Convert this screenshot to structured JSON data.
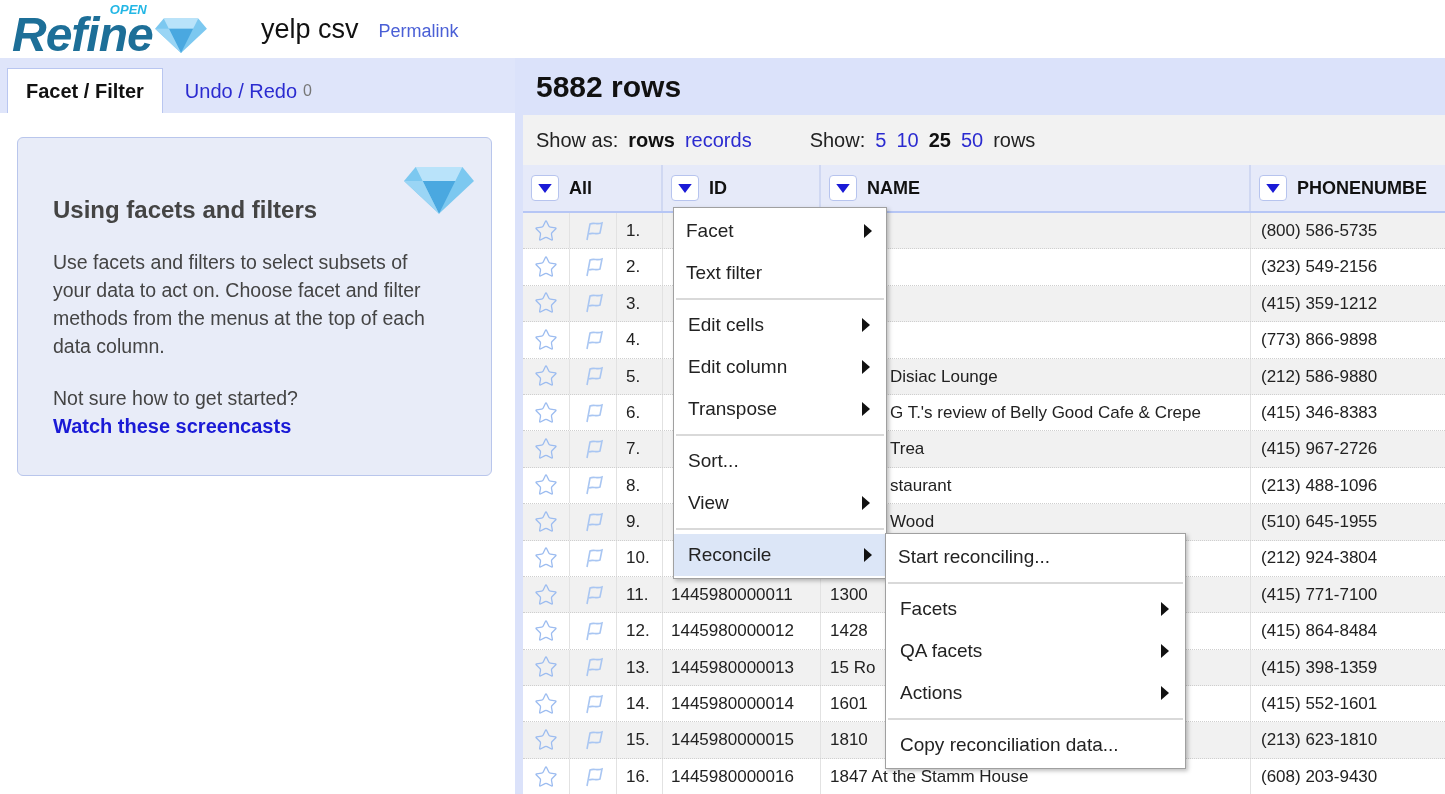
{
  "logo": {
    "word": "Refine",
    "tag": "OPEN"
  },
  "project": {
    "title": "yelp csv",
    "permalink": "Permalink"
  },
  "left_tabs": [
    {
      "label": "Facet / Filter",
      "selected": true
    },
    {
      "label": "Undo / Redo",
      "count": "0",
      "selected": false
    }
  ],
  "help_card": {
    "title": "Using facets and filters",
    "body": "Use facets and filters to select subsets of your data to act on. Choose facet and filter methods from the menus at the top of each data column.",
    "question": "Not sure how to get started?",
    "link": "Watch these screencasts"
  },
  "row_count": "5882 rows",
  "view_bar": {
    "show_as_label": "Show as:",
    "modes": [
      {
        "label": "rows",
        "selected": true
      },
      {
        "label": "records",
        "selected": false
      }
    ],
    "show_label": "Show:",
    "sizes": [
      {
        "label": "5",
        "selected": false
      },
      {
        "label": "10",
        "selected": false
      },
      {
        "label": "25",
        "selected": true
      },
      {
        "label": "50",
        "selected": false
      }
    ],
    "unit": "rows"
  },
  "table": {
    "columns": [
      "All",
      "ID",
      "NAME",
      "PHONENUMBE"
    ],
    "rows": [
      {
        "n": "1.",
        "phone": "(800) 586-5735"
      },
      {
        "n": "2.",
        "phone": "(323) 549-2156"
      },
      {
        "n": "3.",
        "phone": "(415) 359-1212"
      },
      {
        "n": "4.",
        "phone": "(773) 866-9898"
      },
      {
        "n": "5.",
        "name": "Disiac Lounge",
        "name_covered": true,
        "phone": "(212) 586-9880"
      },
      {
        "n": "6.",
        "name": "G T.'s review of Belly Good Cafe & Crepe",
        "name_covered": true,
        "phone": "(415) 346-8383"
      },
      {
        "n": "7.",
        "name": "Trea",
        "name_covered": true,
        "phone": "(415) 967-2726"
      },
      {
        "n": "8.",
        "name": "staurant",
        "name_covered": true,
        "phone": "(213) 488-1096"
      },
      {
        "n": "9.",
        "name": "Wood",
        "name_covered": true,
        "phone": "(510) 645-1955"
      },
      {
        "n": "10.",
        "phone": "(212) 924-3804"
      },
      {
        "n": "11.",
        "id": "1445980000011",
        "name": "1300",
        "name_covered": false,
        "phone": "(415) 771-7100"
      },
      {
        "n": "12.",
        "id": "1445980000012",
        "name": "1428",
        "name_covered": false,
        "phone": "(415) 864-8484"
      },
      {
        "n": "13.",
        "id": "1445980000013",
        "name": "15 Ro",
        "name_covered": false,
        "phone": "(415) 398-1359"
      },
      {
        "n": "14.",
        "id": "1445980000014",
        "name": "1601",
        "name_covered": false,
        "phone": "(415) 552-1601"
      },
      {
        "n": "15.",
        "id": "1445980000015",
        "name": "1810",
        "name_covered": false,
        "phone": "(213) 623-1810"
      },
      {
        "n": "16.",
        "id": "1445980000016",
        "name": "1847 At the Stamm House",
        "name_covered": false,
        "phone": "(608) 203-9430"
      }
    ]
  },
  "column_menu": {
    "sections": [
      [
        {
          "label": "Facet",
          "submenu": true,
          "selected": false
        },
        {
          "label": "Text filter",
          "submenu": false,
          "selected": false
        }
      ],
      [
        {
          "label": "Edit cells",
          "submenu": true,
          "selected": false
        },
        {
          "label": "Edit column",
          "submenu": true,
          "selected": false
        },
        {
          "label": "Transpose",
          "submenu": true,
          "selected": false
        }
      ],
      [
        {
          "label": "Sort...",
          "submenu": false,
          "selected": false
        },
        {
          "label": "View",
          "submenu": true,
          "selected": false
        }
      ],
      [
        {
          "label": "Reconcile",
          "submenu": true,
          "selected": true
        }
      ]
    ]
  },
  "submenu": {
    "sections": [
      [
        {
          "label": "Start reconciling...",
          "submenu": false,
          "selected": false
        }
      ],
      [
        {
          "label": "Facets",
          "submenu": true,
          "selected": false
        },
        {
          "label": "QA facets",
          "submenu": true,
          "selected": false
        },
        {
          "label": "Actions",
          "submenu": true,
          "selected": false
        }
      ],
      [
        {
          "label": "Copy reconciliation data...",
          "submenu": false,
          "selected": false
        }
      ]
    ]
  }
}
